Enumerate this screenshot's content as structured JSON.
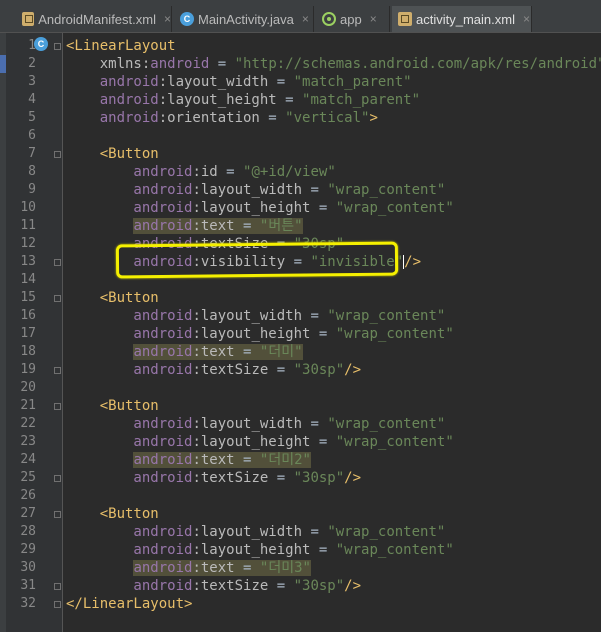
{
  "tabs": [
    {
      "label": "AndroidManifest.xml",
      "icon": "xml-file-icon",
      "active": false
    },
    {
      "label": "MainActivity.java",
      "icon": "class-file-icon",
      "active": false
    },
    {
      "label": "app",
      "icon": "android-module-icon",
      "active": false
    },
    {
      "label": "activity_main.xml",
      "icon": "xml-file-icon",
      "active": true
    }
  ],
  "close_glyph": "×",
  "gutter_icon": "C",
  "line_numbers": [
    "1",
    "2",
    "3",
    "4",
    "5",
    "6",
    "7",
    "8",
    "9",
    "10",
    "11",
    "12",
    "13",
    "14",
    "15",
    "16",
    "17",
    "18",
    "19",
    "20",
    "21",
    "22",
    "23",
    "24",
    "25",
    "26",
    "27",
    "28",
    "29",
    "30",
    "31",
    "32"
  ],
  "code_lines": [
    [
      [
        "tag",
        "<LinearLayout"
      ]
    ],
    [
      [
        "at",
        "    xmlns:"
      ],
      [
        "ns",
        "android"
      ],
      [
        "pl",
        " = "
      ],
      [
        "av",
        "\"http://schemas.android.com/apk/res/android\""
      ]
    ],
    [
      [
        "ns",
        "    android"
      ],
      [
        "at",
        ":layout_width"
      ],
      [
        "pl",
        " = "
      ],
      [
        "av",
        "\"match_parent\""
      ]
    ],
    [
      [
        "ns",
        "    android"
      ],
      [
        "at",
        ":layout_height"
      ],
      [
        "pl",
        " = "
      ],
      [
        "av",
        "\"match_parent\""
      ]
    ],
    [
      [
        "ns",
        "    android"
      ],
      [
        "at",
        ":orientation"
      ],
      [
        "pl",
        " = "
      ],
      [
        "av",
        "\"vertical\""
      ],
      [
        "tag",
        ">"
      ]
    ],
    [],
    [
      [
        "tag",
        "    <Button"
      ]
    ],
    [
      [
        "ns",
        "        android"
      ],
      [
        "at",
        ":id"
      ],
      [
        "pl",
        " = "
      ],
      [
        "av",
        "\"@+id/view\""
      ]
    ],
    [
      [
        "ns",
        "        android"
      ],
      [
        "at",
        ":layout_width"
      ],
      [
        "pl",
        " = "
      ],
      [
        "av",
        "\"wrap_content\""
      ]
    ],
    [
      [
        "ns",
        "        android"
      ],
      [
        "at",
        ":layout_height"
      ],
      [
        "pl",
        " = "
      ],
      [
        "av",
        "\"wrap_content\""
      ]
    ],
    [
      [
        "pl",
        "        "
      ],
      [
        "ns hl",
        "android"
      ],
      [
        "at hl",
        ":text"
      ],
      [
        "pl hl",
        " = "
      ],
      [
        "av hl",
        "\"버튼\""
      ]
    ],
    [
      [
        "ns",
        "        android"
      ],
      [
        "at",
        ":textSize"
      ],
      [
        "pl",
        " = "
      ],
      [
        "av",
        "\"30sp\""
      ]
    ],
    [
      [
        "ns",
        "        android"
      ],
      [
        "at",
        ":visibility"
      ],
      [
        "pl",
        " = "
      ],
      [
        "av",
        "\"invisible\""
      ],
      [
        "caret",
        ""
      ],
      [
        "tag",
        "/>"
      ]
    ],
    [],
    [
      [
        "tag",
        "    <Button"
      ]
    ],
    [
      [
        "ns",
        "        android"
      ],
      [
        "at",
        ":layout_width"
      ],
      [
        "pl",
        " = "
      ],
      [
        "av",
        "\"wrap_content\""
      ]
    ],
    [
      [
        "ns",
        "        android"
      ],
      [
        "at",
        ":layout_height"
      ],
      [
        "pl",
        " = "
      ],
      [
        "av",
        "\"wrap_content\""
      ]
    ],
    [
      [
        "pl",
        "        "
      ],
      [
        "ns hl",
        "android"
      ],
      [
        "at hl",
        ":text"
      ],
      [
        "pl hl",
        " = "
      ],
      [
        "av hl",
        "\"더미\""
      ]
    ],
    [
      [
        "ns",
        "        android"
      ],
      [
        "at",
        ":textSize"
      ],
      [
        "pl",
        " = "
      ],
      [
        "av",
        "\"30sp\""
      ],
      [
        "tag",
        "/>"
      ]
    ],
    [],
    [
      [
        "tag",
        "    <Button"
      ]
    ],
    [
      [
        "ns",
        "        android"
      ],
      [
        "at",
        ":layout_width"
      ],
      [
        "pl",
        " = "
      ],
      [
        "av",
        "\"wrap_content\""
      ]
    ],
    [
      [
        "ns",
        "        android"
      ],
      [
        "at",
        ":layout_height"
      ],
      [
        "pl",
        " = "
      ],
      [
        "av",
        "\"wrap_content\""
      ]
    ],
    [
      [
        "pl",
        "        "
      ],
      [
        "ns hl",
        "android"
      ],
      [
        "at hl",
        ":text"
      ],
      [
        "pl hl",
        " = "
      ],
      [
        "av hl",
        "\"더미2\""
      ]
    ],
    [
      [
        "ns",
        "        android"
      ],
      [
        "at",
        ":textSize"
      ],
      [
        "pl",
        " = "
      ],
      [
        "av",
        "\"30sp\""
      ],
      [
        "tag",
        "/>"
      ]
    ],
    [],
    [
      [
        "tag",
        "    <Button"
      ]
    ],
    [
      [
        "ns",
        "        android"
      ],
      [
        "at",
        ":layout_width"
      ],
      [
        "pl",
        " = "
      ],
      [
        "av",
        "\"wrap_content\""
      ]
    ],
    [
      [
        "ns",
        "        android"
      ],
      [
        "at",
        ":layout_height"
      ],
      [
        "pl",
        " = "
      ],
      [
        "av",
        "\"wrap_content\""
      ]
    ],
    [
      [
        "pl",
        "        "
      ],
      [
        "ns hl",
        "android"
      ],
      [
        "at hl",
        ":text"
      ],
      [
        "pl hl",
        " = "
      ],
      [
        "av hl",
        "\"더미3\""
      ]
    ],
    [
      [
        "ns",
        "        android"
      ],
      [
        "at",
        ":textSize"
      ],
      [
        "pl",
        " = "
      ],
      [
        "av",
        "\"30sp\""
      ],
      [
        "tag",
        "/>"
      ]
    ],
    [
      [
        "tag",
        "</LinearLayout>"
      ]
    ]
  ],
  "fold_lines": [
    1,
    7,
    13,
    15,
    19,
    21,
    25,
    27,
    31,
    32
  ]
}
